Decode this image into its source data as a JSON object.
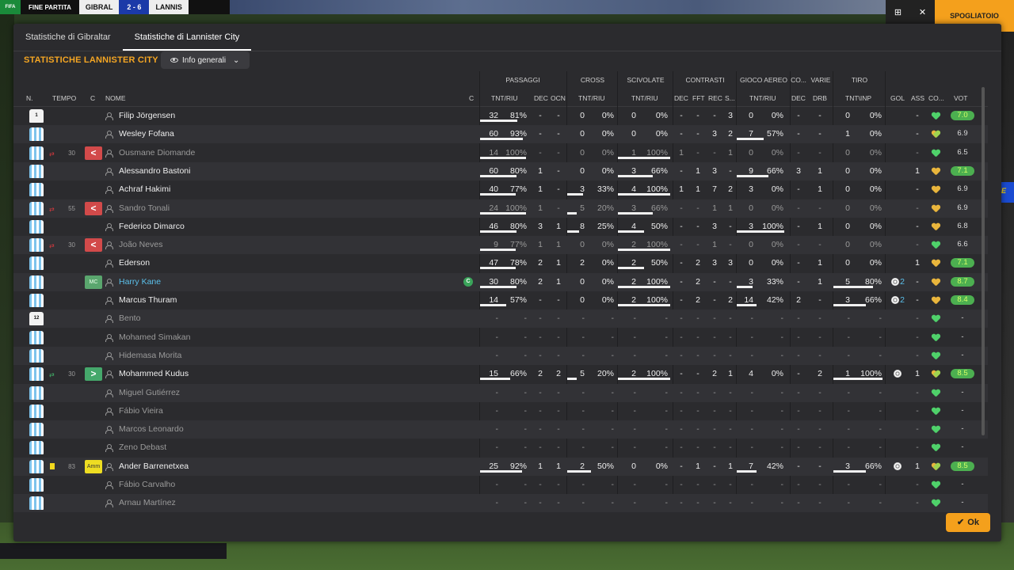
{
  "scoreboard": {
    "logo": "FIFA",
    "status": "FINE PARTITA",
    "team1": "GIBRAL",
    "score": "2 - 6",
    "team2": "LANNIS",
    "right_button": "SPOGLIATOIO"
  },
  "tabs": [
    "Statistiche di Gibraltar",
    "Statistiche di Lannister City"
  ],
  "heading": "STATISTICHE LANNISTER CITY",
  "view_dropdown": "Info generali",
  "groups": {
    "passaggi": "PASSAGGI",
    "cross": "CROSS",
    "scivolate": "SCIVOLATE",
    "contrasti": "CONTRASTI",
    "gioco_aereo": "GIOCO AEREO",
    "co": "CO...",
    "varie": "VARIE",
    "tiro": "TIRO"
  },
  "columns": {
    "num": "N.",
    "tempo": "TEMPO",
    "c1": "C",
    "nome": "NOME",
    "c2": "C",
    "pass_tr": "TNT/RIU",
    "pass_dec": "DEC",
    "pass_ocn": "OCN",
    "cross_tr": "TNT/RIU",
    "sciv_tr": "TNT/RIU",
    "con_dec": "DEC",
    "con_fft": "FFT",
    "con_rec": "REC",
    "con_s": "S...",
    "air_tr": "TNT/RIU",
    "co_dec": "DEC",
    "var_drb": "DRB",
    "tiro_ti": "TNT\\INP",
    "gol": "GOL",
    "ass": "ASS",
    "co2": "CO...",
    "vot": "VOT"
  },
  "players": [
    {
      "name": "Filip Jörgensen",
      "shirt": "gk",
      "num": "1",
      "dim": false,
      "pt": "32",
      "pp": "81%",
      "pf": 0.81,
      "pd": "-",
      "po": "-",
      "ct": "0",
      "cp": "0%",
      "cf": 0,
      "st": "0",
      "sp": "0%",
      "sf": 0,
      "k1": "-",
      "k2": "-",
      "k3": "-",
      "k4": "3",
      "at": "0",
      "ap": "0%",
      "af": 0,
      "cd": "-",
      "dr": "-",
      "tt": "0",
      "tp": "0%",
      "tf": 0,
      "gol": "",
      "ass": "-",
      "heart": "g",
      "vote": "7.0",
      "hi": true
    },
    {
      "name": "Wesley Fofana",
      "shirt": "out",
      "dim": false,
      "pt": "60",
      "pp": "93%",
      "pf": 0.93,
      "pd": "-",
      "po": "-",
      "ct": "0",
      "cp": "0%",
      "cf": 0,
      "st": "0",
      "sp": "0%",
      "sf": 0,
      "k1": "-",
      "k2": "-",
      "k3": "3",
      "k4": "2",
      "at": "7",
      "ap": "57%",
      "af": 0.57,
      "cd": "-",
      "dr": "-",
      "tt": "1",
      "tp": "0%",
      "tf": 0,
      "gol": "",
      "ass": "-",
      "heart": "gy",
      "vote": "6.9",
      "hi": false
    },
    {
      "name": "Ousmane Diomande",
      "shirt": "out",
      "dim": true,
      "sub": "out",
      "tempo": "30",
      "pt": "14",
      "pp": "100%",
      "pf": 1,
      "pd": "-",
      "po": "-",
      "ct": "0",
      "cp": "0%",
      "cf": 0,
      "st": "1",
      "sp": "100%",
      "sf": 1,
      "k1": "1",
      "k2": "-",
      "k3": "-",
      "k4": "1",
      "at": "0",
      "ap": "0%",
      "af": 0,
      "cd": "-",
      "dr": "-",
      "tt": "0",
      "tp": "0%",
      "tf": 0,
      "gol": "",
      "ass": "-",
      "heart": "g",
      "vote": "6.5",
      "hi": false
    },
    {
      "name": "Alessandro Bastoni",
      "shirt": "out",
      "dim": false,
      "pt": "60",
      "pp": "80%",
      "pf": 0.8,
      "pd": "1",
      "po": "-",
      "ct": "0",
      "cp": "0%",
      "cf": 0,
      "st": "3",
      "sp": "66%",
      "sf": 0.66,
      "k1": "-",
      "k2": "1",
      "k3": "3",
      "k4": "-",
      "at": "9",
      "ap": "66%",
      "af": 0.66,
      "cd": "3",
      "dr": "1",
      "tt": "0",
      "tp": "0%",
      "tf": 0,
      "gol": "",
      "ass": "1",
      "heart": "y",
      "vote": "7.1",
      "hi": true
    },
    {
      "name": "Achraf Hakimi",
      "shirt": "out",
      "dim": false,
      "pt": "40",
      "pp": "77%",
      "pf": 0.77,
      "pd": "1",
      "po": "-",
      "ct": "3",
      "cp": "33%",
      "cf": 0.33,
      "st": "4",
      "sp": "100%",
      "sf": 1,
      "k1": "1",
      "k2": "1",
      "k3": "7",
      "k4": "2",
      "at": "3",
      "ap": "0%",
      "af": 0,
      "cd": "-",
      "dr": "1",
      "tt": "0",
      "tp": "0%",
      "tf": 0,
      "gol": "",
      "ass": "-",
      "heart": "y",
      "vote": "6.9",
      "hi": false
    },
    {
      "name": "Sandro Tonali",
      "shirt": "out",
      "dim": true,
      "sub": "out",
      "tempo": "55",
      "pt": "24",
      "pp": "100%",
      "pf": 1,
      "pd": "1",
      "po": "-",
      "ct": "5",
      "cp": "20%",
      "cf": 0.2,
      "st": "3",
      "sp": "66%",
      "sf": 0.66,
      "k1": "-",
      "k2": "-",
      "k3": "1",
      "k4": "1",
      "at": "0",
      "ap": "0%",
      "af": 0,
      "cd": "-",
      "dr": "-",
      "tt": "0",
      "tp": "0%",
      "tf": 0,
      "gol": "",
      "ass": "-",
      "heart": "y",
      "vote": "6.9",
      "hi": false
    },
    {
      "name": "Federico Dimarco",
      "shirt": "out",
      "dim": false,
      "pt": "46",
      "pp": "80%",
      "pf": 0.8,
      "pd": "3",
      "po": "1",
      "ct": "8",
      "cp": "25%",
      "cf": 0.25,
      "st": "4",
      "sp": "50%",
      "sf": 0.5,
      "k1": "-",
      "k2": "-",
      "k3": "3",
      "k4": "-",
      "at": "3",
      "ap": "100%",
      "af": 1,
      "cd": "-",
      "dr": "1",
      "tt": "0",
      "tp": "0%",
      "tf": 0,
      "gol": "",
      "ass": "-",
      "heart": "y",
      "vote": "6.8",
      "hi": false
    },
    {
      "name": "João Neves",
      "shirt": "out",
      "dim": true,
      "sub": "out",
      "tempo": "30",
      "pt": "9",
      "pp": "77%",
      "pf": 0.77,
      "pd": "1",
      "po": "1",
      "ct": "0",
      "cp": "0%",
      "cf": 0,
      "st": "2",
      "sp": "100%",
      "sf": 1,
      "k1": "-",
      "k2": "-",
      "k3": "1",
      "k4": "-",
      "at": "0",
      "ap": "0%",
      "af": 0,
      "cd": "-",
      "dr": "-",
      "tt": "0",
      "tp": "0%",
      "tf": 0,
      "gol": "",
      "ass": "-",
      "heart": "g",
      "vote": "6.6",
      "hi": false
    },
    {
      "name": "Ederson",
      "shirt": "out",
      "dim": false,
      "pt": "47",
      "pp": "78%",
      "pf": 0.78,
      "pd": "2",
      "po": "1",
      "ct": "2",
      "cp": "0%",
      "cf": 0,
      "st": "2",
      "sp": "50%",
      "sf": 0.5,
      "k1": "-",
      "k2": "2",
      "k3": "3",
      "k4": "3",
      "at": "0",
      "ap": "0%",
      "af": 0,
      "cd": "-",
      "dr": "1",
      "tt": "0",
      "tp": "0%",
      "tf": 0,
      "gol": "",
      "ass": "1",
      "heart": "y",
      "vote": "7.1",
      "hi": true
    },
    {
      "name": "Harry Kane",
      "shirt": "out",
      "dim": false,
      "cap": true,
      "pos": "MC",
      "captain": "C",
      "pt": "30",
      "pp": "80%",
      "pf": 0.8,
      "pd": "2",
      "po": "1",
      "ct": "0",
      "cp": "0%",
      "cf": 0,
      "st": "2",
      "sp": "100%",
      "sf": 1,
      "k1": "-",
      "k2": "2",
      "k3": "-",
      "k4": "-",
      "at": "3",
      "ap": "33%",
      "af": 0.33,
      "cd": "-",
      "dr": "1",
      "tt": "5",
      "tp": "80%",
      "tf": 0.8,
      "gol": "2",
      "goalicon": true,
      "ass": "-",
      "heart": "y",
      "vote": "8.7",
      "hi": true
    },
    {
      "name": "Marcus Thuram",
      "shirt": "out",
      "dim": false,
      "pt": "14",
      "pp": "57%",
      "pf": 0.57,
      "pd": "-",
      "po": "-",
      "ct": "0",
      "cp": "0%",
      "cf": 0,
      "st": "2",
      "sp": "100%",
      "sf": 1,
      "k1": "-",
      "k2": "2",
      "k3": "-",
      "k4": "2",
      "at": "14",
      "ap": "42%",
      "af": 0.42,
      "cd": "2",
      "dr": "-",
      "tt": "3",
      "tp": "66%",
      "tf": 0.66,
      "gol": "2",
      "goalicon": true,
      "ass": "-",
      "heart": "y",
      "vote": "8.4",
      "hi": true
    },
    {
      "name": "Bento",
      "shirt": "gk",
      "num": "12",
      "dim": true,
      "pt": "-",
      "pp": "-",
      "pd": "-",
      "po": "-",
      "ct": "-",
      "cp": "-",
      "st": "-",
      "sp": "-",
      "k1": "-",
      "k2": "-",
      "k3": "-",
      "k4": "-",
      "at": "-",
      "ap": "-",
      "cd": "-",
      "dr": "-",
      "tt": "-",
      "tp": "-",
      "gol": "",
      "ass": "-",
      "heart": "g",
      "vote": "-",
      "hi": false
    },
    {
      "name": "Mohamed Simakan",
      "shirt": "out",
      "dim": true,
      "pt": "-",
      "pp": "-",
      "pd": "-",
      "po": "-",
      "ct": "-",
      "cp": "-",
      "st": "-",
      "sp": "-",
      "k1": "-",
      "k2": "-",
      "k3": "-",
      "k4": "-",
      "at": "-",
      "ap": "-",
      "cd": "-",
      "dr": "-",
      "tt": "-",
      "tp": "-",
      "gol": "",
      "ass": "-",
      "heart": "g",
      "vote": "-",
      "hi": false
    },
    {
      "name": "Hidemasa Morita",
      "shirt": "out",
      "dim": true,
      "pt": "-",
      "pp": "-",
      "pd": "-",
      "po": "-",
      "ct": "-",
      "cp": "-",
      "st": "-",
      "sp": "-",
      "k1": "-",
      "k2": "-",
      "k3": "-",
      "k4": "-",
      "at": "-",
      "ap": "-",
      "cd": "-",
      "dr": "-",
      "tt": "-",
      "tp": "-",
      "gol": "",
      "ass": "-",
      "heart": "g",
      "vote": "-",
      "hi": false
    },
    {
      "name": "Mohammed Kudus",
      "shirt": "out",
      "dim": false,
      "sub": "in",
      "tempo": "30",
      "pt": "15",
      "pp": "66%",
      "pf": 0.66,
      "pd": "2",
      "po": "2",
      "ct": "5",
      "cp": "20%",
      "cf": 0.2,
      "st": "2",
      "sp": "100%",
      "sf": 1,
      "k1": "-",
      "k2": "-",
      "k3": "2",
      "k4": "1",
      "at": "4",
      "ap": "0%",
      "af": 0,
      "cd": "-",
      "dr": "2",
      "tt": "1",
      "tp": "100%",
      "tf": 1,
      "gol": "",
      "goalicon": true,
      "ass": "1",
      "heart": "gy",
      "vote": "8.5",
      "hi": true
    },
    {
      "name": "Miguel Gutiérrez",
      "shirt": "out",
      "dim": true,
      "pt": "-",
      "pp": "-",
      "pd": "-",
      "po": "-",
      "ct": "-",
      "cp": "-",
      "st": "-",
      "sp": "-",
      "k1": "-",
      "k2": "-",
      "k3": "-",
      "k4": "-",
      "at": "-",
      "ap": "-",
      "cd": "-",
      "dr": "-",
      "tt": "-",
      "tp": "-",
      "gol": "",
      "ass": "-",
      "heart": "g",
      "vote": "-",
      "hi": false
    },
    {
      "name": "Fábio Vieira",
      "shirt": "out",
      "dim": true,
      "pt": "-",
      "pp": "-",
      "pd": "-",
      "po": "-",
      "ct": "-",
      "cp": "-",
      "st": "-",
      "sp": "-",
      "k1": "-",
      "k2": "-",
      "k3": "-",
      "k4": "-",
      "at": "-",
      "ap": "-",
      "cd": "-",
      "dr": "-",
      "tt": "-",
      "tp": "-",
      "gol": "",
      "ass": "-",
      "heart": "g",
      "vote": "-",
      "hi": false
    },
    {
      "name": "Marcos Leonardo",
      "shirt": "out",
      "dim": true,
      "pt": "-",
      "pp": "-",
      "pd": "-",
      "po": "-",
      "ct": "-",
      "cp": "-",
      "st": "-",
      "sp": "-",
      "k1": "-",
      "k2": "-",
      "k3": "-",
      "k4": "-",
      "at": "-",
      "ap": "-",
      "cd": "-",
      "dr": "-",
      "tt": "-",
      "tp": "-",
      "gol": "",
      "ass": "-",
      "heart": "g",
      "vote": "-",
      "hi": false
    },
    {
      "name": "Zeno Debast",
      "shirt": "out",
      "dim": true,
      "pt": "-",
      "pp": "-",
      "pd": "-",
      "po": "-",
      "ct": "-",
      "cp": "-",
      "st": "-",
      "sp": "-",
      "k1": "-",
      "k2": "-",
      "k3": "-",
      "k4": "-",
      "at": "-",
      "ap": "-",
      "cd": "-",
      "dr": "-",
      "tt": "-",
      "tp": "-",
      "gol": "",
      "ass": "-",
      "heart": "g",
      "vote": "-",
      "hi": false
    },
    {
      "name": "Ander Barrenetxea",
      "shirt": "out",
      "dim": false,
      "yellow": true,
      "tempo": "83",
      "pos": "Amm",
      "pt": "25",
      "pp": "92%",
      "pf": 0.92,
      "pd": "1",
      "po": "1",
      "ct": "2",
      "cp": "50%",
      "cf": 0.5,
      "st": "0",
      "sp": "0%",
      "sf": 0,
      "k1": "-",
      "k2": "1",
      "k3": "-",
      "k4": "1",
      "at": "7",
      "ap": "42%",
      "af": 0.42,
      "cd": "-",
      "dr": "-",
      "tt": "3",
      "tp": "66%",
      "tf": 0.66,
      "gol": "",
      "goalicon": true,
      "ass": "1",
      "heart": "gy",
      "vote": "8.5",
      "hi": true
    },
    {
      "name": "Fábio Carvalho",
      "shirt": "out",
      "dim": true,
      "pt": "-",
      "pp": "-",
      "pd": "-",
      "po": "-",
      "ct": "-",
      "cp": "-",
      "st": "-",
      "sp": "-",
      "k1": "-",
      "k2": "-",
      "k3": "-",
      "k4": "-",
      "at": "-",
      "ap": "-",
      "cd": "-",
      "dr": "-",
      "tt": "-",
      "tp": "-",
      "gol": "",
      "ass": "-",
      "heart": "g",
      "vote": "-",
      "hi": false
    },
    {
      "name": "Arnau Martínez",
      "shirt": "out",
      "dim": true,
      "pt": "-",
      "pp": "-",
      "pd": "-",
      "po": "-",
      "ct": "-",
      "cp": "-",
      "st": "-",
      "sp": "-",
      "k1": "-",
      "k2": "-",
      "k3": "-",
      "k4": "-",
      "at": "-",
      "ap": "-",
      "cd": "-",
      "dr": "-",
      "tt": "-",
      "tp": "-",
      "gol": "",
      "ass": "-",
      "heart": "g",
      "vote": "-",
      "hi": false
    }
  ],
  "ok_button": "Ok",
  "banner_text": "THE G"
}
